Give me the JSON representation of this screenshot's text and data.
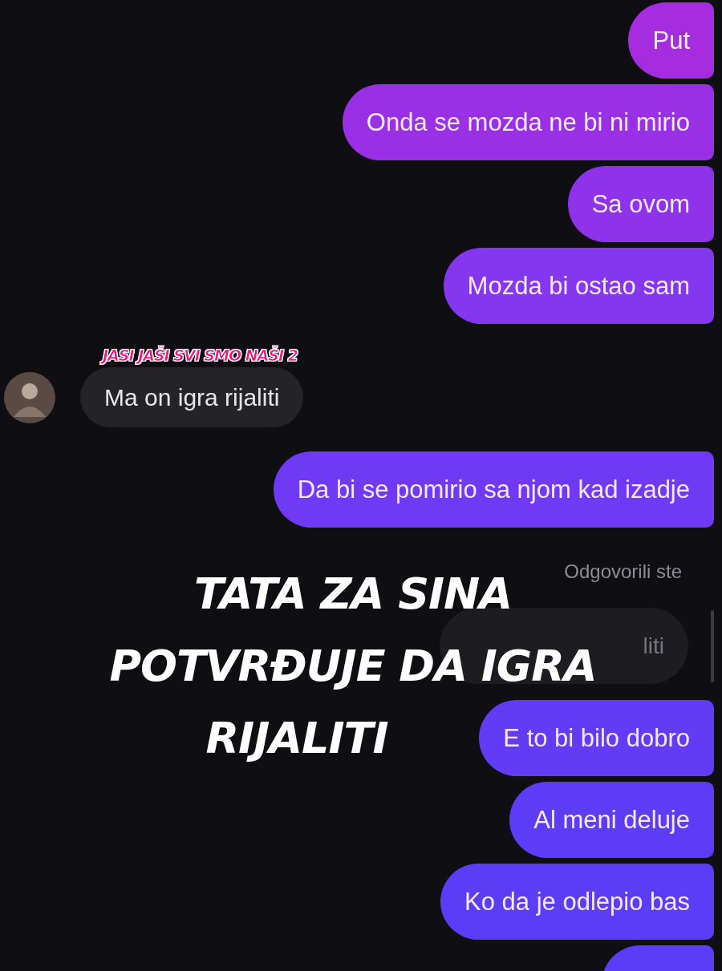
{
  "messages": [
    {
      "kind": "sent",
      "text": "Put",
      "color": "#a62ddf"
    },
    {
      "kind": "sent",
      "text": "Onda se mozda ne bi ni mirio",
      "color": "#9a30e6"
    },
    {
      "kind": "sent",
      "text": "Sa ovom",
      "color": "#8f33eb"
    },
    {
      "kind": "sent",
      "text": "Mozda bi ostao sam",
      "color": "#8536ef"
    },
    {
      "kind": "group_label",
      "text": "JASI JAŠI SVI SMO NAŠI 2"
    },
    {
      "kind": "received",
      "text": "Ma on igra rijaliti"
    },
    {
      "kind": "sent",
      "text": "Da bi se pomirio sa njom kad izadje",
      "color": "#7039f5"
    },
    {
      "kind": "reply_label",
      "text": "Odgovorili ste"
    },
    {
      "kind": "quote",
      "text": "liti"
    },
    {
      "kind": "sent",
      "text": "E to bi bilo dobro",
      "color": "#623bf7"
    },
    {
      "kind": "sent",
      "text": "Al meni deluje",
      "color": "#5d3cf7"
    },
    {
      "kind": "sent",
      "text": "Ko da je odlepio bas",
      "color": "#5b3cf7"
    },
    {
      "kind": "sent_cut",
      "color": "#5b3cf7"
    }
  ],
  "caption": [
    "TATA ZA SINA",
    "POTVRĐUJE DA IGRA",
    "RIJALITI"
  ]
}
